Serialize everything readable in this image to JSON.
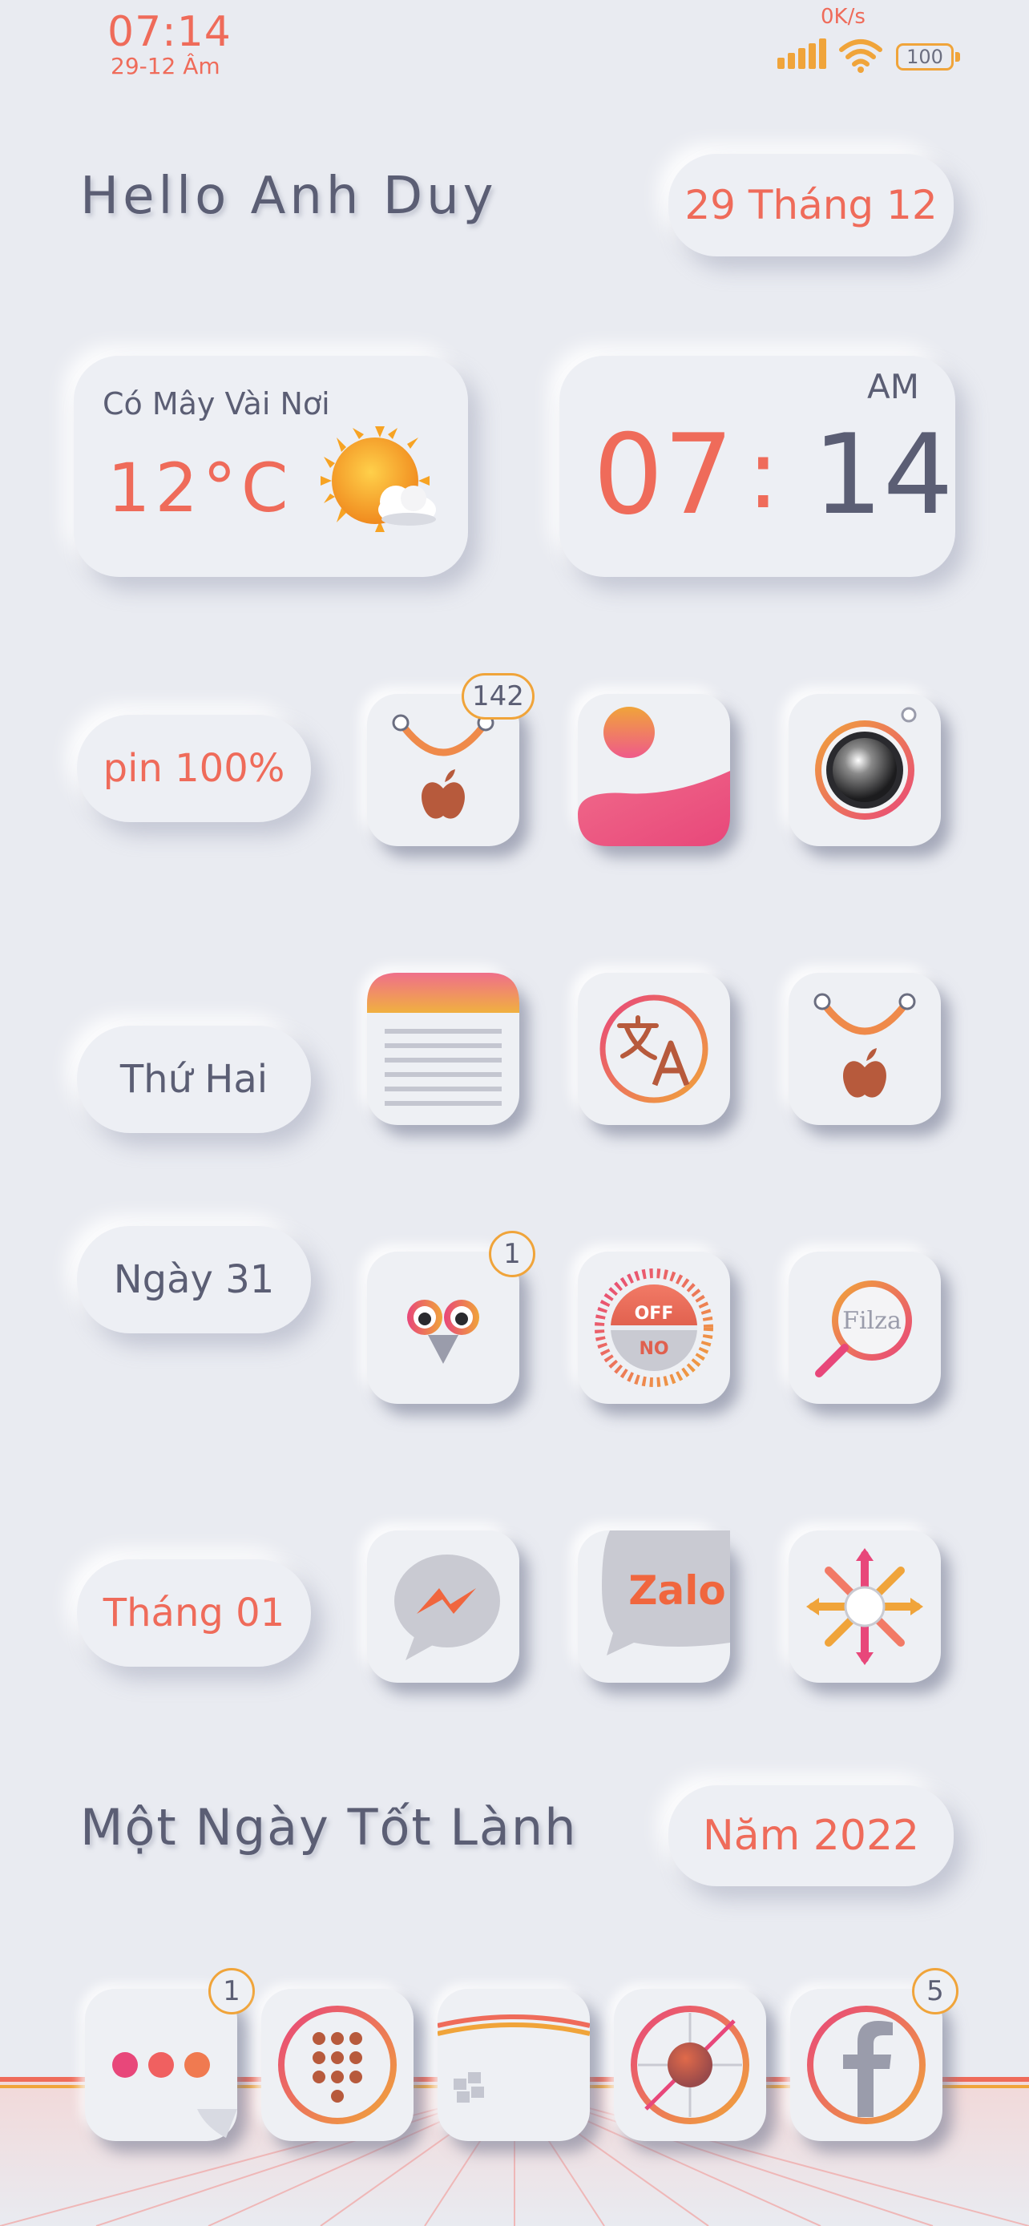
{
  "status_bar": {
    "time": "07:14",
    "date": "29-12 Âm",
    "net_speed": "0K/s",
    "battery": "100"
  },
  "header": {
    "greeting": "Hello Anh Duy",
    "lunar_date": "29 Tháng 12"
  },
  "weather": {
    "description": "Có Mây Vài Nơi",
    "temperature": "12°C",
    "icon": "sun-cloud-icon"
  },
  "clock": {
    "ampm": "AM",
    "hour": "07",
    "separator": ":",
    "minute": "14"
  },
  "pills": {
    "battery": "pin 100%",
    "weekday": "Thứ Hai",
    "day": "Ngày 31",
    "month": "Tháng 01"
  },
  "apps": [
    {
      "icon": "app-store-icon",
      "badge": "142"
    },
    {
      "icon": "photos-icon",
      "badge": ""
    },
    {
      "icon": "camera-icon",
      "badge": ""
    },
    {
      "icon": "notes-icon",
      "badge": ""
    },
    {
      "icon": "translate-icon",
      "badge": ""
    },
    {
      "icon": "app-store-icon",
      "badge": ""
    },
    {
      "icon": "owl-icon",
      "badge": "1"
    },
    {
      "icon": "on-off-icon",
      "badge": ""
    },
    {
      "icon": "filza-icon",
      "badge": ""
    },
    {
      "icon": "messenger-icon",
      "badge": ""
    },
    {
      "icon": "zalo-icon",
      "badge": ""
    },
    {
      "icon": "pinwheel-icon",
      "badge": ""
    }
  ],
  "icon_text": {
    "off": "OFF",
    "no": "NO",
    "filza": "Filza",
    "zalo": "Zalo"
  },
  "footer": {
    "slogan": "Một Ngày Tốt Lành",
    "year": "Năm 2022"
  },
  "dock": [
    {
      "icon": "messages-icon",
      "badge": "1"
    },
    {
      "icon": "phone-keypad-icon",
      "badge": ""
    },
    {
      "icon": "cydia-icon",
      "badge": ""
    },
    {
      "icon": "safari-icon",
      "badge": ""
    },
    {
      "icon": "facebook-icon",
      "badge": "5"
    }
  ],
  "colors": {
    "background": "#e9ebf1",
    "accent_coral": "#ef6b5a",
    "accent_orange": "#f0a43a",
    "accent_pink": "#e8477a",
    "text_slate": "#5b5e74"
  }
}
